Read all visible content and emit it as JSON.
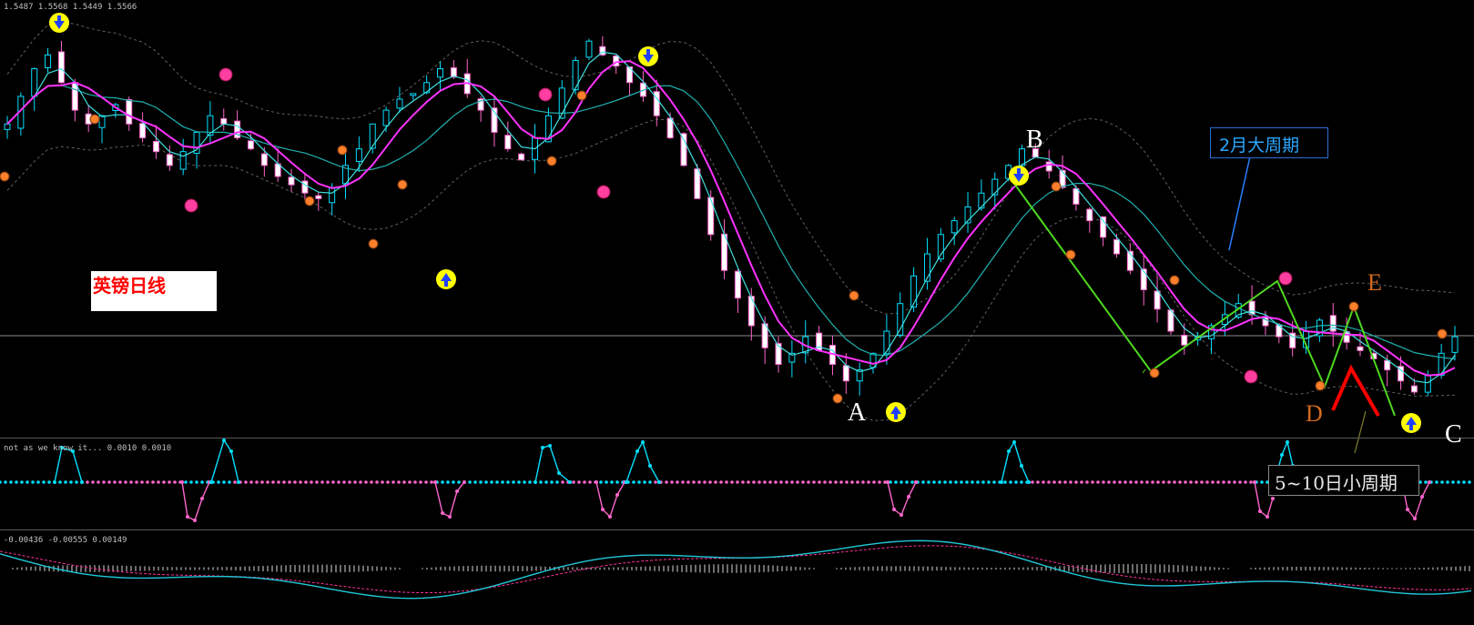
{
  "panels": {
    "main": {
      "ohlc_info": "1.5487 1.5568 1.5449 1.5566"
    },
    "osc1": {
      "info": "not as we know it... 0.0010 0.0010"
    },
    "osc2": {
      "info": "-0.00436 -0.00555 0.00149"
    }
  },
  "annotations": {
    "title_box": "英镑日线",
    "big_cycle": "2月大周期",
    "small_cycle": "5~10日小周期",
    "points": [
      "A",
      "B",
      "C",
      "D",
      "E"
    ]
  },
  "colors": {
    "bull_candle": "#00e0ff",
    "bear_candle": "#ff66cc",
    "ma_fast": "#40e0e0",
    "ma_mid": "#ff33ff",
    "ma_slow": "#20b0b0",
    "band": "#606060",
    "zigzag": "#4ed81e",
    "red_v": "#ff0000",
    "marker_orange": "#ff7f2a",
    "arrow_yellow": "#ffff00",
    "arrow_blue": "#2040ff"
  },
  "chart_data": {
    "type": "candlestick",
    "symbol_note": "英镑日线",
    "price_info": {
      "open": 1.5487,
      "high": 1.5568,
      "low": 1.5449,
      "close": 1.5566
    },
    "close_trend": [
      1.575,
      1.585,
      1.595,
      1.6,
      1.59,
      1.58,
      1.575,
      1.578,
      1.582,
      1.575,
      1.57,
      1.565,
      1.56,
      1.565,
      1.572,
      1.578,
      1.575,
      1.57,
      1.566,
      1.56,
      1.556,
      1.553,
      1.55,
      1.548,
      1.552,
      1.56,
      1.566,
      1.575,
      1.58,
      1.584,
      1.586,
      1.59,
      1.595,
      1.592,
      1.586,
      1.58,
      1.572,
      1.566,
      1.562,
      1.57,
      1.578,
      1.588,
      1.598,
      1.605,
      1.6,
      1.596,
      1.59,
      1.585,
      1.578,
      1.57,
      1.56,
      1.548,
      1.535,
      1.522,
      1.512,
      1.502,
      1.494,
      1.488,
      1.492,
      1.498,
      1.493,
      1.488,
      1.482,
      1.486,
      1.492,
      1.5,
      1.51,
      1.52,
      1.528,
      1.535,
      1.54,
      1.545,
      1.55,
      1.555,
      1.56,
      1.566,
      1.563,
      1.558,
      1.552,
      1.546,
      1.54,
      1.534,
      1.528,
      1.522,
      1.515,
      1.508,
      1.5,
      1.495,
      1.498,
      1.502,
      1.506,
      1.51,
      1.506,
      1.502,
      1.498,
      1.494,
      1.5,
      1.504,
      1.5,
      1.496,
      1.493,
      1.49,
      1.486,
      1.482,
      1.478,
      1.484,
      1.492,
      1.498
    ]
  }
}
